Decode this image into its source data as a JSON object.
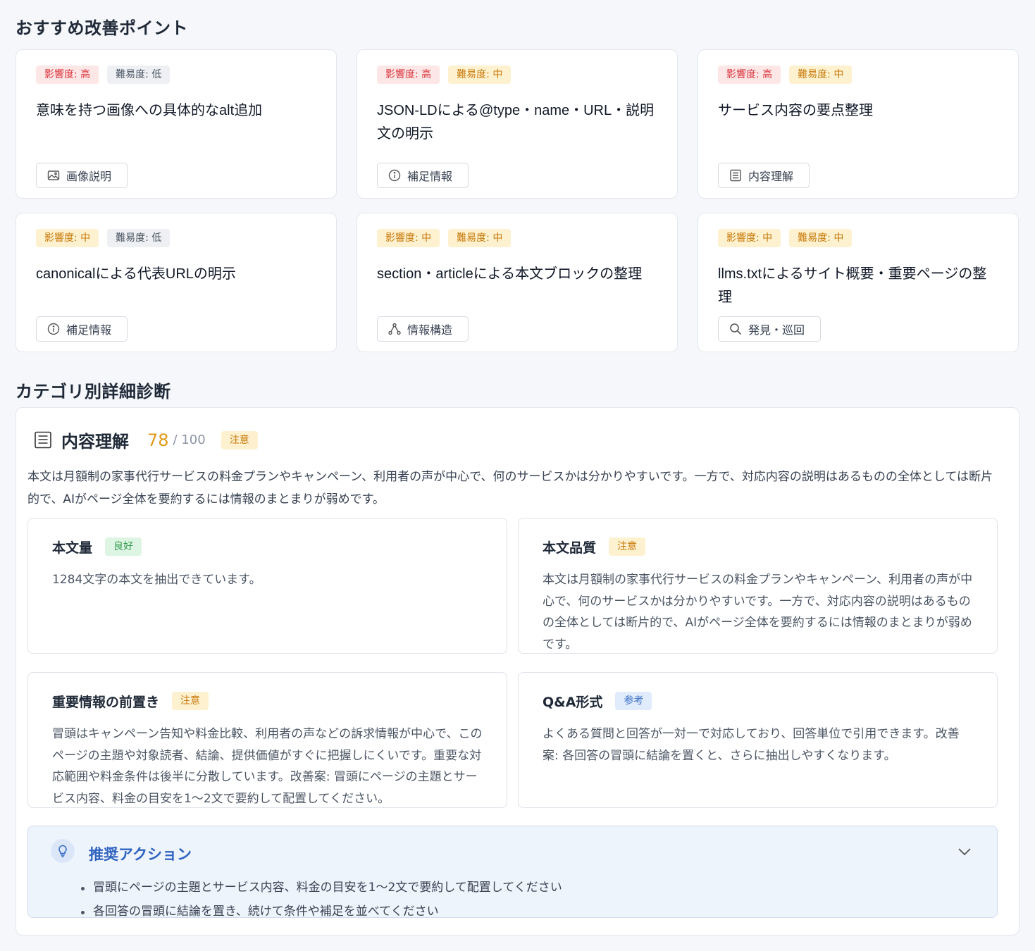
{
  "recommendations": {
    "title": "おすすめ改善ポイント",
    "cards": [
      {
        "impact": "影響度: 高",
        "difficulty": "難易度: 低",
        "title": "意味を持つ画像への具体的なalt追加",
        "tag": "画像説明"
      },
      {
        "impact": "影響度: 高",
        "difficulty": "難易度: 中",
        "title": "JSON-LDによる@type・name・URL・説明文の明示",
        "tag": "補足情報"
      },
      {
        "impact": "影響度: 高",
        "difficulty": "難易度: 中",
        "title": "サービス内容の要点整理",
        "tag": "内容理解"
      },
      {
        "impact": "影響度: 中",
        "difficulty": "難易度: 低",
        "title": "canonicalによる代表URLの明示",
        "tag": "補足情報"
      },
      {
        "impact": "影響度: 中",
        "difficulty": "難易度: 中",
        "title": "section・articleによる本文ブロックの整理",
        "tag": "情報構造"
      },
      {
        "impact": "影響度: 中",
        "difficulty": "難易度: 中",
        "title": "llms.txtによるサイト概要・重要ページの整理",
        "tag": "発見・巡回"
      }
    ]
  },
  "category": {
    "title": "カテゴリ別詳細診断",
    "detail": {
      "name": "内容理解",
      "score": "78",
      "max": "/ 100",
      "status": "注意",
      "summary": "本文は月額制の家事代行サービスの料金プランやキャンペーン、利用者の声が中心で、何のサービスかは分かりやすいです。一方で、対応内容の説明はあるものの全体としては断片的で、AIがページ全体を要約するには情報のまとまりが弱めです。",
      "items": [
        {
          "title": "本文量",
          "status": "良好",
          "body": "1284文字の本文を抽出できています。"
        },
        {
          "title": "本文品質",
          "status": "注意",
          "body": "本文は月額制の家事代行サービスの料金プランやキャンペーン、利用者の声が中心で、何のサービスかは分かりやすいです。一方で、対応内容の説明はあるものの全体としては断片的で、AIがページ全体を要約するには情報のまとまりが弱めです。"
        },
        {
          "title": "重要情報の前置き",
          "status": "注意",
          "body": "冒頭はキャンペーン告知や料金比較、利用者の声などの訴求情報が中心で、このページの主題や対象読者、結論、提供価値がすぐに把握しにくいです。重要な対応範囲や料金条件は後半に分散しています。改善案: 冒頭にページの主題とサービス内容、料金の目安を1〜2文で要約して配置してください。"
        },
        {
          "title": "Q&A形式",
          "status": "参考",
          "body": "よくある質問と回答が一対一で対応しており、回答単位で引用できます。改善案: 各回答の冒頭に結論を置くと、さらに抽出しやすくなります。"
        }
      ],
      "actions": {
        "title": "推奨アクション",
        "items": [
          "冒頭にページの主題とサービス内容、料金の目安を1〜2文で要約して配置してください",
          "各回答の冒頭に結論を置き、続けて条件や補足を並べてください"
        ]
      }
    }
  },
  "colors": {
    "impact_high": "#d9363e",
    "medium": "#c9790a",
    "good": "#2f9a4c",
    "reference": "#3b6fc6",
    "score": "#e09a1a"
  },
  "icons": [
    "image-icon",
    "info-icon",
    "document-icon",
    "hierarchy-icon",
    "search-icon",
    "lightbulb-icon",
    "chevron-down-icon"
  ]
}
